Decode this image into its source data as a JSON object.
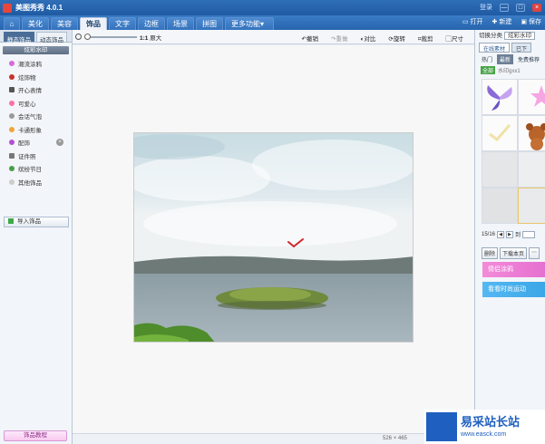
{
  "app": {
    "title": "美图秀秀 4.0.1",
    "login": "登录",
    "min": "—",
    "max": "□",
    "close": "×"
  },
  "tabs": [
    {
      "label": "⌂"
    },
    {
      "label": "美化"
    },
    {
      "label": "美容"
    },
    {
      "label": "饰品",
      "active": true
    },
    {
      "label": "文字"
    },
    {
      "label": "边框"
    },
    {
      "label": "场景"
    },
    {
      "label": "拼图"
    },
    {
      "label": "更多功能▾"
    }
  ],
  "top_actions": {
    "open": "打开",
    "new": "新建",
    "save": "保存"
  },
  "left": {
    "subtabs": [
      "静态饰品",
      "动态饰品"
    ],
    "category_header": "炫彩水印",
    "categories": [
      {
        "label": "潮流涂鸦",
        "icon": "heart-icon",
        "color": "#d86bd8"
      },
      {
        "label": "炫饰物",
        "icon": "flower-icon",
        "color": "#c8322d"
      },
      {
        "label": "开心表情",
        "icon": "smile-icon",
        "color": "#555555"
      },
      {
        "label": "可爱心",
        "icon": "heart-icon",
        "color": "#ff6fa8"
      },
      {
        "label": "会话气泡",
        "icon": "bubble-icon",
        "color": "#9a9a9a"
      },
      {
        "label": "卡通形象",
        "icon": "cartoon-icon",
        "color": "#f2a33a"
      },
      {
        "label": "配饰",
        "icon": "bow-icon",
        "color": "#b24fd6"
      },
      {
        "label": "证件照",
        "icon": "id-icon",
        "color": "#777777"
      },
      {
        "label": "缤纷节日",
        "icon": "festival-icon",
        "color": "#4a9e4a"
      },
      {
        "label": "其他饰品",
        "icon": "star-icon",
        "color": "#cccccc"
      }
    ],
    "import_label": "导入饰品",
    "tutorial_label": "饰品教程"
  },
  "toolbar": {
    "zoom_label": "1:1",
    "zoom_fit": "原大",
    "undo": "撤销",
    "redo": "重做",
    "contrast": "对比",
    "rotate": "旋转",
    "crop": "裁剪",
    "size": "尺寸"
  },
  "status": {
    "width": "526",
    "x": "×",
    "height": "465"
  },
  "right": {
    "switch_label": "切换分类",
    "switch_value": "炫彩水印",
    "tabs": [
      "在线素材",
      "已下"
    ],
    "subtabs": [
      "热门",
      "最新",
      "免费推荐"
    ],
    "all_tag": "全部",
    "other_tag": "水印gxx1",
    "pager": {
      "page": "15/16",
      "goto": "到"
    },
    "actions": [
      "删除",
      "下载本页",
      "⋯"
    ],
    "promo1": "情侣涂鸦",
    "promo2": "看看时尚运动"
  },
  "watermark": {
    "text": "易采站长站",
    "url": "www.easck.com"
  }
}
